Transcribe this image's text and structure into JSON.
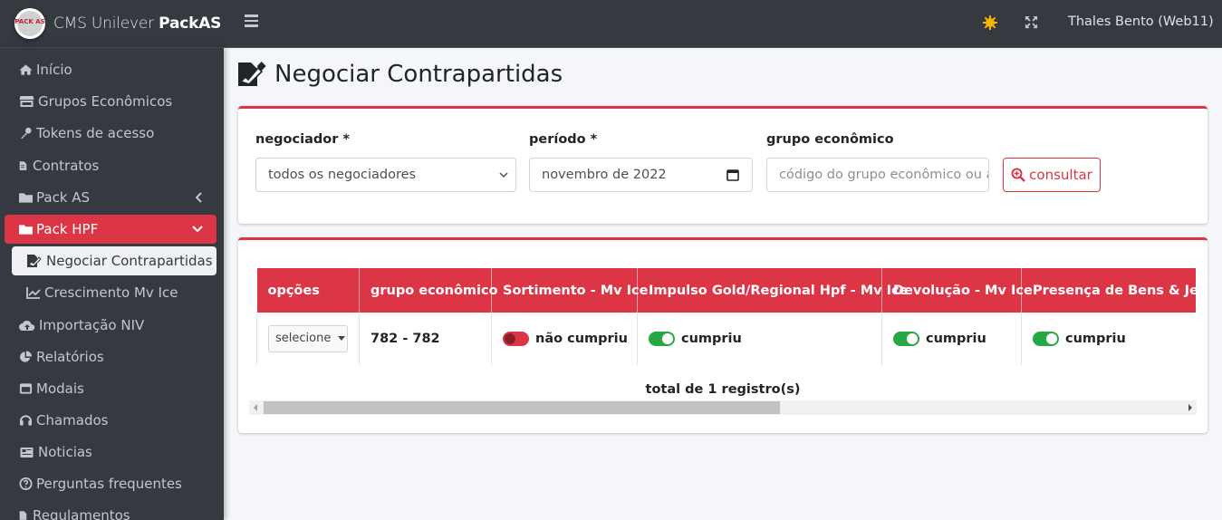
{
  "brand": {
    "logo_text": "PACK AS",
    "name_light": "CMS Unilever ",
    "name_bold": "PackAS"
  },
  "topbar": {
    "user": "Thales Bento (Web11)"
  },
  "sidebar": {
    "items": [
      {
        "label": "Início",
        "icon": "home-icon"
      },
      {
        "label": "Grupos Econômicos",
        "icon": "store-icon"
      },
      {
        "label": "Tokens de acesso",
        "icon": "key-icon"
      },
      {
        "label": "Contratos",
        "icon": "file-contract-icon"
      },
      {
        "label": "Pack AS",
        "icon": "folder-icon"
      },
      {
        "label": "Pack HPF",
        "icon": "folder-icon"
      },
      {
        "label": "Negociar Contrapartidas",
        "icon": "file-signature-icon"
      },
      {
        "label": "Crescimento Mv Ice",
        "icon": "chart-line-icon"
      },
      {
        "label": "Importação NIV",
        "icon": "cloud-upload-icon"
      },
      {
        "label": "Relatórios",
        "icon": "chart-pie-icon"
      },
      {
        "label": "Modais",
        "icon": "window-icon"
      },
      {
        "label": "Chamados",
        "icon": "headset-icon"
      },
      {
        "label": "Noticias",
        "icon": "newspaper-icon"
      },
      {
        "label": "Perguntas frequentes",
        "icon": "question-circle-icon"
      },
      {
        "label": "Regulamentos",
        "icon": "file-icon"
      }
    ]
  },
  "page": {
    "title": "Negociar Contrapartidas"
  },
  "filters": {
    "negociador_label": "negociador *",
    "negociador_value": "todos os negociadores",
    "periodo_label": "período *",
    "periodo_value": "novembro de 2022",
    "grupo_label": "grupo econômico",
    "grupo_placeholder": "código do grupo econômico ou a",
    "consult_label": "consultar"
  },
  "table": {
    "headers": [
      "opções",
      "grupo econômico",
      "Sortimento - Mv Ice",
      "Impulso Gold/Regional Hpf - Mv Ice",
      "Devolução - Mv Ice",
      "Presença de Bens & Jerry"
    ],
    "row": {
      "select_label": "selecione",
      "grupo": "782 - 782",
      "sortimento": "não cumpriu",
      "impulso": "cumpriu",
      "devolucao": "cumpriu",
      "presenca": "cumpriu"
    },
    "total": "total de 1 registro(s)"
  },
  "colors": {
    "accent": "#dc3545",
    "success": "#28a745",
    "sidebar": "#343a40"
  }
}
